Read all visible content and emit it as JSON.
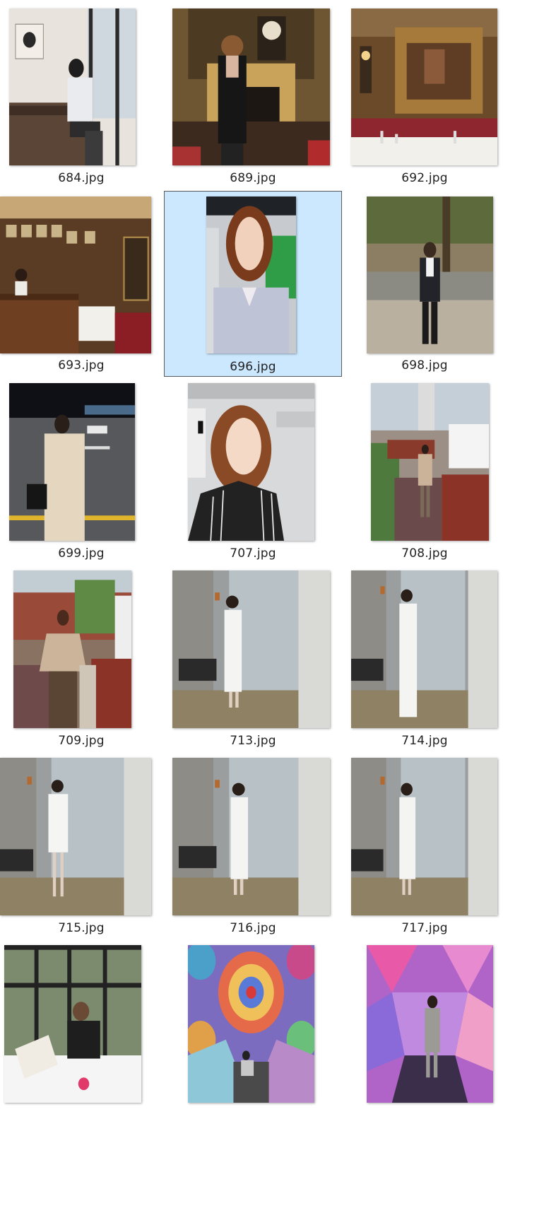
{
  "files": [
    {
      "name": "684.jpg",
      "scene": "cafe-window",
      "selected": false
    },
    {
      "name": "689.jpg",
      "scene": "fireplace-portrait",
      "selected": false
    },
    {
      "name": "692.jpg",
      "scene": "ornate-restaurant",
      "selected": false
    },
    {
      "name": "693.jpg",
      "scene": "restaurant-bar",
      "selected": false
    },
    {
      "name": "696.jpg",
      "scene": "studio-portrait",
      "selected": true
    },
    {
      "name": "698.jpg",
      "scene": "park-suit",
      "selected": false
    },
    {
      "name": "699.jpg",
      "scene": "night-street",
      "selected": false
    },
    {
      "name": "707.jpg",
      "scene": "studio-stripes",
      "selected": false
    },
    {
      "name": "708.jpg",
      "scene": "brick-path",
      "selected": false
    },
    {
      "name": "709.jpg",
      "scene": "brick-closeup",
      "selected": false
    },
    {
      "name": "713.jpg",
      "scene": "fitting-room-dress",
      "selected": false
    },
    {
      "name": "714.jpg",
      "scene": "fitting-room-gown",
      "selected": false
    },
    {
      "name": "715.jpg",
      "scene": "fitting-room-coat",
      "selected": false
    },
    {
      "name": "716.jpg",
      "scene": "fitting-room-short",
      "selected": false
    },
    {
      "name": "717.jpg",
      "scene": "fitting-room-short",
      "selected": false
    },
    {
      "name": "",
      "scene": "window-dining",
      "selected": false
    },
    {
      "name": "",
      "scene": "kaleidoscope",
      "selected": false
    },
    {
      "name": "",
      "scene": "crystal-room",
      "selected": false
    }
  ]
}
